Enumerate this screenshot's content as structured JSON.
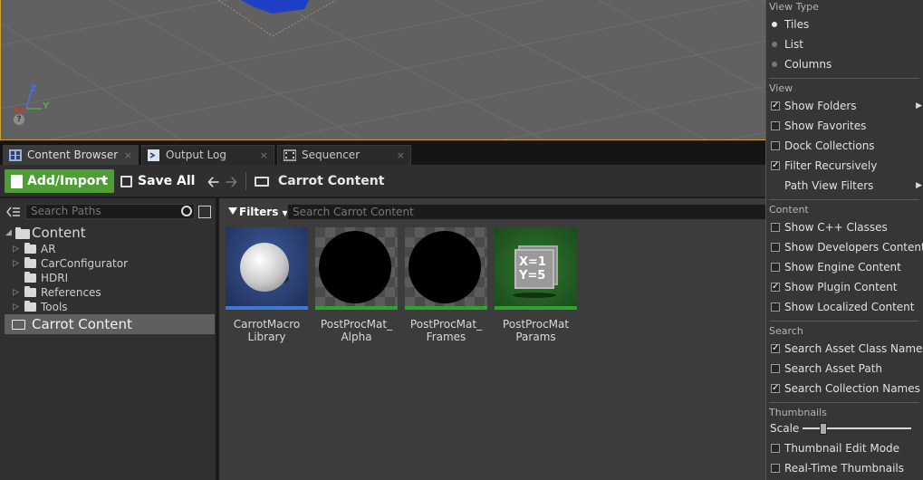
{
  "tabs": [
    {
      "label": "Content Browser",
      "close": "×"
    },
    {
      "label": "Output Log",
      "close": "×"
    },
    {
      "label": "Sequencer",
      "close": "×"
    }
  ],
  "toolbar": {
    "add_label": "Add/Import",
    "save_label": "Save All",
    "back_arrow": "🡠",
    "forward_arrow": "🡢",
    "breadcrumb": "Carrot Content"
  },
  "left_panel": {
    "search_placeholder": "Search Paths",
    "root": "Content",
    "tree": [
      "AR",
      "CarConfigurator",
      "HDRI",
      "References",
      "Tools"
    ],
    "selected": "Carrot Content"
  },
  "content": {
    "filters_label": "Filters",
    "search_placeholder": "Search Carrot Content",
    "assets": [
      {
        "line1": "CarrotMacro",
        "line2": "Library",
        "bar_color": "#3d7ad6"
      },
      {
        "line1": "PostProcMat_",
        "line2": "Alpha",
        "bar_color": "#2ea32e"
      },
      {
        "line1": "PostProcMat_",
        "line2": "Frames",
        "bar_color": "#2ea32e"
      },
      {
        "line1": "PostProcMat",
        "line2": "Params",
        "bar_color": "#2ea32e"
      }
    ],
    "params_icon_text": [
      "X=1",
      "Y=5"
    ]
  },
  "menu": {
    "view_type_header": "View Type",
    "view_types": [
      {
        "label": "Tiles",
        "selected": true
      },
      {
        "label": "List",
        "selected": false
      },
      {
        "label": "Columns",
        "selected": false
      }
    ],
    "view_header": "View",
    "view_items": [
      {
        "label": "Show Folders",
        "checked": true,
        "submenu": true
      },
      {
        "label": "Show Favorites",
        "checked": false
      },
      {
        "label": "Dock Collections",
        "checked": false
      },
      {
        "label": "Filter Recursively",
        "checked": true
      },
      {
        "label": "Path View Filters",
        "checked": null,
        "submenu": true
      }
    ],
    "content_header": "Content",
    "content_items": [
      {
        "label": "Show C++ Classes",
        "checked": false
      },
      {
        "label": "Show Developers Content",
        "checked": false
      },
      {
        "label": "Show Engine Content",
        "checked": false
      },
      {
        "label": "Show Plugin Content",
        "checked": true
      },
      {
        "label": "Show Localized Content",
        "checked": false
      }
    ],
    "search_header": "Search",
    "search_items": [
      {
        "label": "Search Asset Class Names",
        "checked": true
      },
      {
        "label": "Search Asset Path",
        "checked": false
      },
      {
        "label": "Search Collection Names",
        "checked": true
      }
    ],
    "thumbnails_header": "Thumbnails",
    "scale_label": "Scale",
    "scale_value": 0.2,
    "thumb_items": [
      {
        "label": "Thumbnail Edit Mode",
        "checked": false
      },
      {
        "label": "Real-Time Thumbnails",
        "checked": false
      }
    ]
  },
  "colors": {
    "accent_green": "#4d9f35",
    "viewport_border": "#c9a23a"
  },
  "gizmo": {
    "z": "Z",
    "y": "Y",
    "help": "?"
  }
}
